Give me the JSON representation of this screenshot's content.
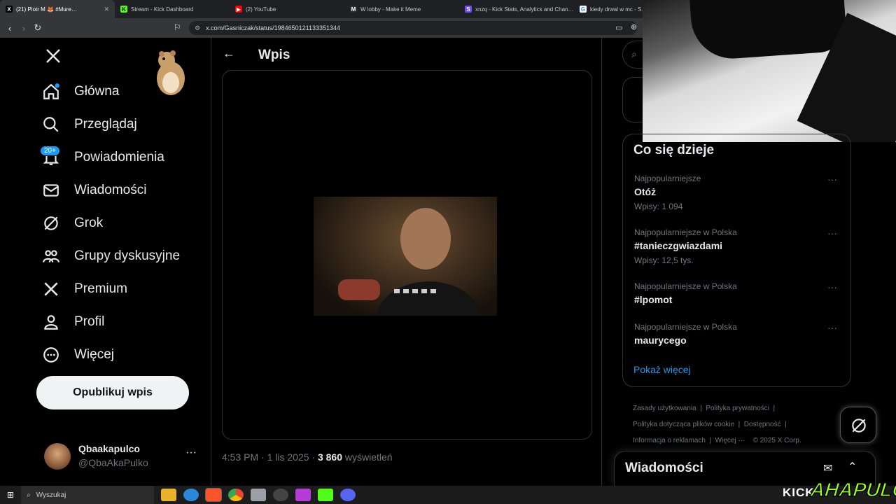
{
  "tabs": [
    {
      "title": "(21) Piotr M 🦊 #Mure…",
      "fav": "X",
      "favbg": "#000",
      "favcolor": "#fff"
    },
    {
      "title": "Stream - Kick Dashboard",
      "fav": "K",
      "favbg": "#53fc18",
      "favcolor": "#000"
    },
    {
      "title": "(2) YouTube",
      "fav": "▶",
      "favbg": "#ff0000",
      "favcolor": "#fff"
    },
    {
      "title": "W lobby - Make it Meme",
      "fav": "M",
      "favbg": "#2b2b2b",
      "favcolor": "#fff"
    },
    {
      "title": "xnzq - Kick Stats, Analytics and Chan…",
      "fav": "S",
      "favbg": "#6b4cff",
      "favcolor": "#fff"
    },
    {
      "title": "kiedy drwal w mc - S…",
      "fav": "G",
      "favbg": "#fff",
      "favcolor": "#4285f4"
    }
  ],
  "address": {
    "url": "x.com/Gasniczak/status/1984650121133351344"
  },
  "nav": {
    "items": [
      {
        "label": "Główna",
        "icon": "home-icon"
      },
      {
        "label": "Przeglądaj",
        "icon": "search-icon"
      },
      {
        "label": "Powiadomienia",
        "icon": "bell-icon"
      },
      {
        "label": "Wiadomości",
        "icon": "mail-icon"
      },
      {
        "label": "Grok",
        "icon": "grok-icon"
      },
      {
        "label": "Grupy dyskusyjne",
        "icon": "communities-icon"
      },
      {
        "label": "Premium",
        "icon": "x-icon"
      },
      {
        "label": "Profil",
        "icon": "profile-icon"
      },
      {
        "label": "Więcej",
        "icon": "more-circle-icon"
      }
    ],
    "notif_badge": "20+",
    "publish": "Opublikuj wpis"
  },
  "account": {
    "name": "Qbaakapulco",
    "handle": "@QbaAkaPulko"
  },
  "post": {
    "header": "Wpis",
    "time": "4:53 PM · 1 lis 2025 · ",
    "views": "3 860",
    "views_label": " wyświetleń"
  },
  "trends": {
    "title": "Co się dzieje",
    "items": [
      {
        "sub": "Najpopularniejsze",
        "title": "Otóż",
        "count": "Wpisy: 1 094"
      },
      {
        "sub": "Najpopularniejsze w Polska",
        "title": "#tanieczgwiazdami",
        "count": "Wpisy: 12,5 tys."
      },
      {
        "sub": "Najpopularniejsze w Polska",
        "title": "#lpomot",
        "count": ""
      },
      {
        "sub": "Najpopularniejsze w Polska",
        "title": "maurycego",
        "count": ""
      }
    ],
    "show_more": "Pokaż więcej"
  },
  "footer": {
    "links": [
      "Zasady użytkowania",
      "Polityka prywatności",
      "Polityka dotycząca plików cookie",
      "Dostępność",
      "Informacja o reklamach",
      "Więcej ···"
    ],
    "copyright": "© 2025 X Corp."
  },
  "messages": {
    "title": "Wiadomości"
  },
  "taskbar": {
    "search": "Wyszukaj"
  },
  "overlay": {
    "kick": "KICK",
    "brand": "AHAPULCO"
  },
  "colors": {
    "accent": "#1d9bf0",
    "brand_green": "#9cff1f"
  }
}
